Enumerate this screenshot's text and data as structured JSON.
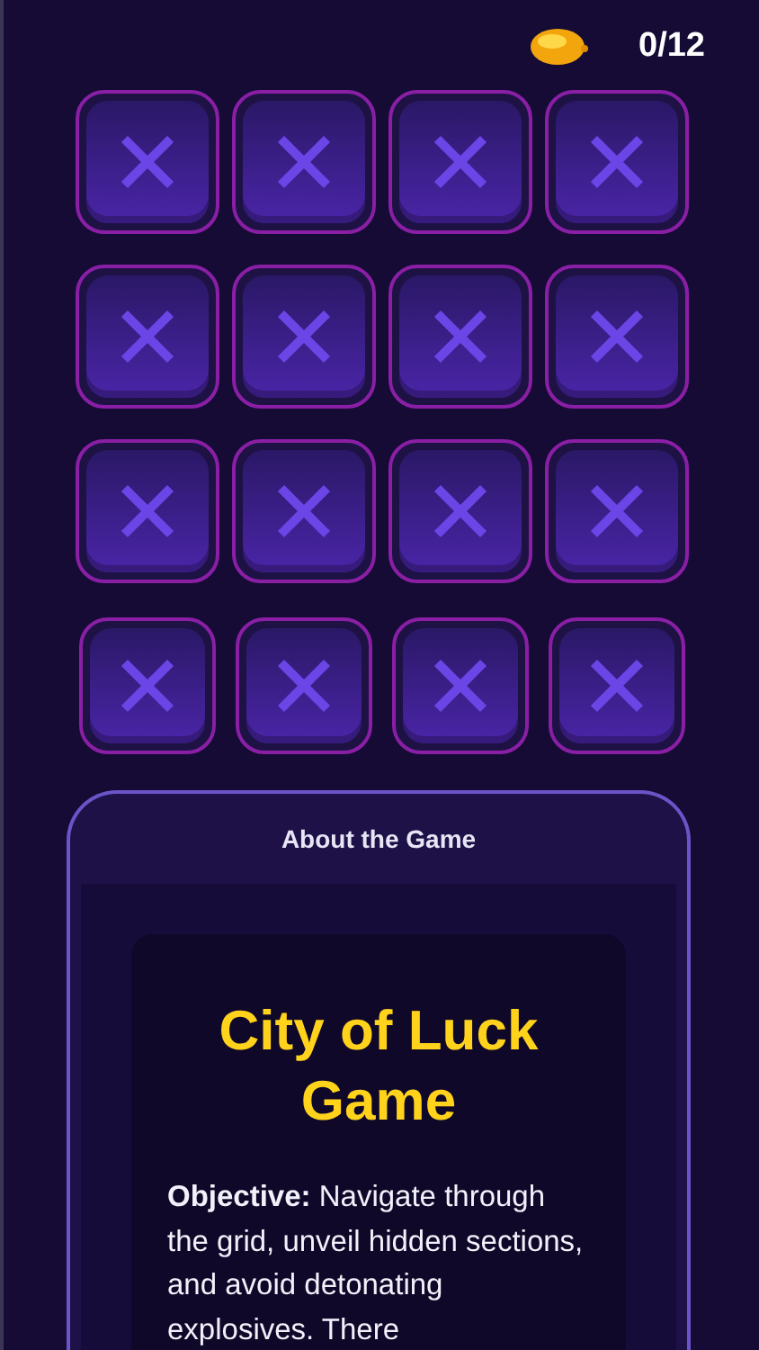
{
  "counter": {
    "value": "0/12"
  },
  "tiles": [
    {
      "kind": "closed"
    },
    {
      "kind": "closed"
    },
    {
      "kind": "closed"
    },
    {
      "kind": "closed"
    },
    {
      "kind": "closed"
    },
    {
      "kind": "closed"
    },
    {
      "kind": "closed"
    },
    {
      "kind": "closed"
    },
    {
      "kind": "closed"
    },
    {
      "kind": "closed"
    },
    {
      "kind": "closed"
    },
    {
      "kind": "closed"
    },
    {
      "kind": "closed"
    },
    {
      "kind": "closed"
    },
    {
      "kind": "closed"
    },
    {
      "kind": "closed"
    }
  ],
  "about": {
    "header": "About the Game",
    "title": "City of Luck Game",
    "text": "**Objective:** Navigate through the grid, unveil hidden sections, and avoid detonating explosives. There"
  }
}
